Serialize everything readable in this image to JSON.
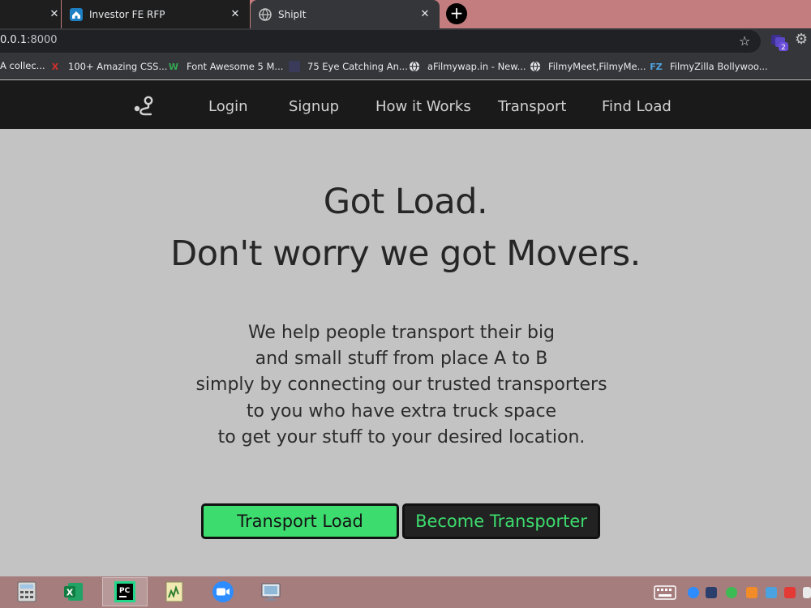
{
  "browser": {
    "tabs": [
      {
        "label": "",
        "close": "✕"
      },
      {
        "label": "Investor FE RFP",
        "close": "✕"
      },
      {
        "label": "ShipIt",
        "close": "✕"
      }
    ],
    "new_tab": "+",
    "url_host": "0.0.1",
    "url_port": ":8000",
    "extension_badge": "2",
    "bookmarks": [
      "A collec...",
      "100+ Amazing CSS...",
      "Font Awesome 5 M...",
      "75 Eye Catching An...",
      "aFilmywap.in - New...",
      "FilmyMeet,FilmyMe...",
      "FilmyZilla Bollywoo..."
    ],
    "bookmark_icon_text": [
      "",
      "X",
      "W",
      "",
      "",
      "",
      "FZ"
    ]
  },
  "site": {
    "nav": [
      "Login",
      "Signup",
      "How it Works",
      "Transport",
      "Find Load"
    ],
    "hero_line1": "Got Load.",
    "hero_line2": "Don't worry we got Movers.",
    "description": [
      "We help people transport their big",
      "and small stuff from place A to B",
      "simply by connecting our trusted transporters",
      "to you who have extra truck space",
      "to get your stuff to your desired location."
    ],
    "cta_primary": "Transport Load",
    "cta_secondary": "Become Transporter"
  },
  "colors": {
    "page_bg": "#c3c3c3",
    "nav_bg": "#1a1a1a",
    "accent_green": "#3ddc6e",
    "tabstrip": "#c47d7f",
    "taskbar": "#a57d7d"
  },
  "taskbar": {
    "apps": [
      "calculator-icon",
      "excel-icon",
      "pycharm-icon",
      "notepad-icon",
      "zoom-icon",
      "remote-desktop-icon"
    ],
    "pycharm_label": "PC",
    "excel_label": "X"
  }
}
